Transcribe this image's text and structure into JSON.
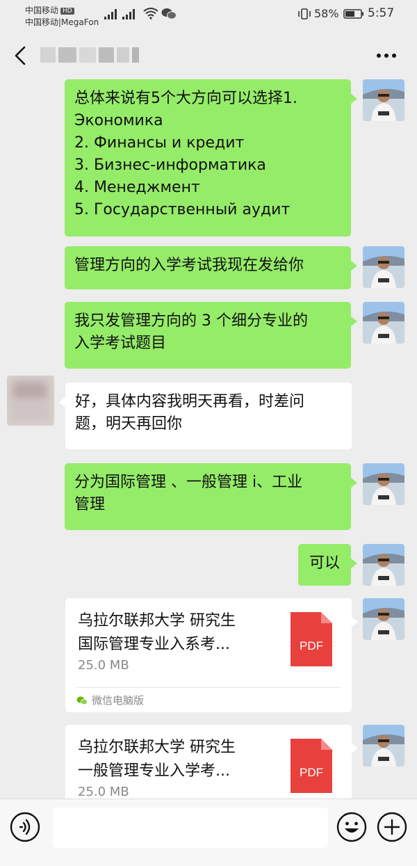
{
  "status_bar": {
    "carrier1": "中国移动",
    "carrier1_badge": "HD",
    "carrier2": "中国移动|MegaFon",
    "battery_percent": "58%",
    "time": "5:57"
  },
  "header": {
    "back_icon": "chevron-left-icon",
    "more_icon": "more-horizontal-icon"
  },
  "messages": [
    {
      "lines": [
        "总体来说有5个大方向可以选择1.",
        "Экономика",
        "2. Финансы и кредит",
        "3. Бизнес-информатика",
        "4. Менеджмент",
        "5. Государственный аудит"
      ]
    },
    {
      "lines": [
        "管理方向的入学考试我现在发给你"
      ]
    },
    {
      "lines": [
        "我只发管理方向的 3 个细分专业的",
        "入学考试题目"
      ]
    },
    {
      "lines": [
        "好，具体内容我明天再看，时差问",
        "题，明天再回你"
      ]
    },
    {
      "lines": [
        "分为国际管理 、一般管理 i、工业",
        "管理"
      ]
    },
    {
      "lines": [
        "可以"
      ]
    }
  ],
  "files": [
    {
      "name_line1": "乌拉尔联邦大学 研究生",
      "name_line2": "国际管理专业入系考...",
      "size": "25.0 MB",
      "type": "PDF",
      "source": "微信电脑版"
    },
    {
      "name_line1": "乌拉尔联邦大学 研究生",
      "name_line2": "一般管理专业入学考...",
      "size": "25.0 MB",
      "type": "PDF"
    }
  ],
  "colors": {
    "outgoing_bubble": "#95ec69",
    "incoming_bubble": "#ffffff",
    "chat_background": "#ededed",
    "pdf_icon": "#e8413d"
  }
}
